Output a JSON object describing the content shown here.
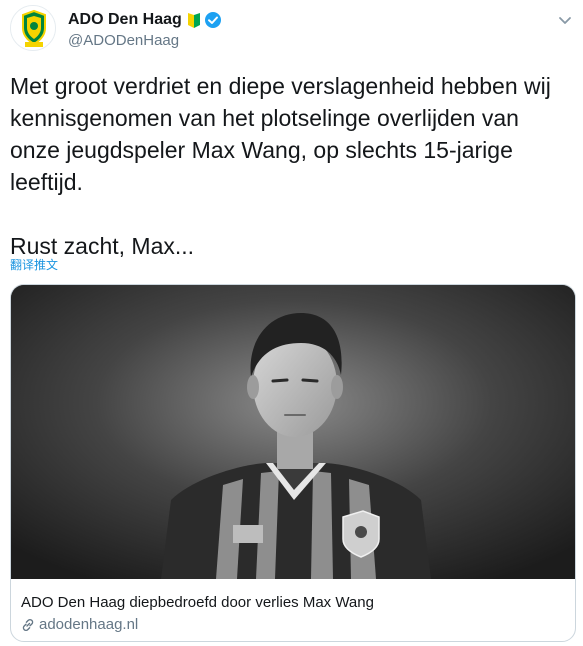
{
  "header": {
    "display_name": "ADO Den Haag",
    "handle": "@ADODenHaag",
    "shield_icon": "beginner-shield-icon",
    "verified_icon": "verified-badge-icon",
    "menu_icon": "chevron-down-icon"
  },
  "tweet": {
    "text": "Met groot verdriet en diepe verslagenheid hebben wij kennisgenomen van het plotselinge overlijden van onze jeugdspeler Max Wang, op slechts 15-jarige leeftijd.\n\nRust zacht, Max...",
    "translate_label": "翻译推文"
  },
  "card": {
    "title": "ADO Den Haag diepbedroefd door verlies Max Wang",
    "domain": "adodenhaag.nl",
    "image_icon": "player-portrait-photo"
  },
  "colors": {
    "link": "#1b95e0",
    "verified": "#1da1f2",
    "secondary_text": "#657786",
    "border": "#ccd6dd",
    "club_yellow": "#f5d300",
    "club_green": "#00843d"
  }
}
